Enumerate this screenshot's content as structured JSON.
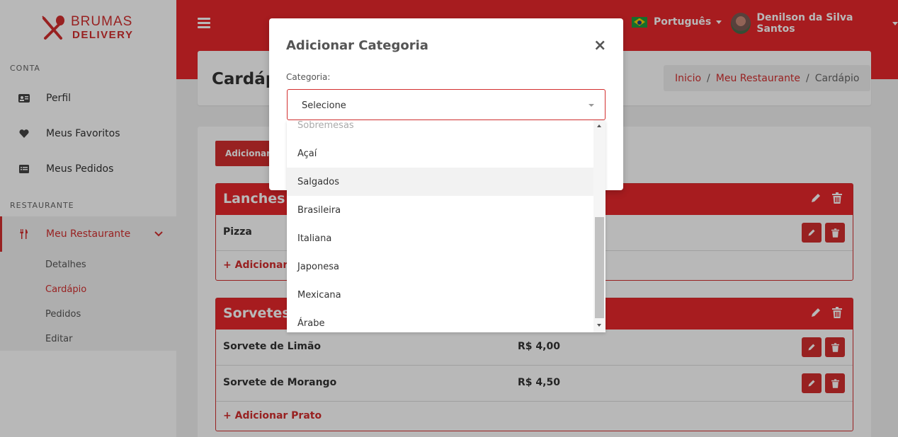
{
  "brand": {
    "line1": "BRUMAS",
    "line2": "DELIVERY"
  },
  "sidebar": {
    "section_account": "CONTA",
    "section_restaurant": "RESTAURANTE",
    "items": [
      {
        "label": "Perfil",
        "icon": "id-card-icon"
      },
      {
        "label": "Meus Favoritos",
        "icon": "heart-icon"
      },
      {
        "label": "Meus Pedidos",
        "icon": "list-icon"
      },
      {
        "label": "Meu Restaurante",
        "icon": "utensils-icon"
      }
    ],
    "sub_items": [
      "Detalhes",
      "Cardápio",
      "Pedidos",
      "Editar"
    ]
  },
  "header": {
    "language": "Português",
    "user_name": "Denilson da Silva Santos"
  },
  "page": {
    "title": "Cardápio",
    "breadcrumb": [
      "Inicio",
      "Meu Restaurante",
      "Cardápio"
    ],
    "add_category_button": "Adicionar Categoria",
    "add_dish_label": "Adicionar Prato"
  },
  "categories": [
    {
      "name": "Lanches",
      "dishes": [
        {
          "name": "Pizza",
          "price": ""
        }
      ]
    },
    {
      "name": "Sorvetes",
      "dishes": [
        {
          "name": "Sorvete de Limão",
          "price": "R$ 4,00"
        },
        {
          "name": "Sorvete de Morango",
          "price": "R$ 4,50"
        }
      ]
    }
  ],
  "modal": {
    "title": "Adicionar Categoria",
    "field_label": "Categoria:",
    "select_value": "Selecione",
    "options": [
      "Sobremesas",
      "Açaí",
      "Salgados",
      "Brasileira",
      "Italiana",
      "Japonesa",
      "Mexicana",
      "Árabe"
    ],
    "highlighted_option": "Salgados"
  },
  "colors": {
    "primary": "#e8282b",
    "accent": "#d32f2f"
  }
}
